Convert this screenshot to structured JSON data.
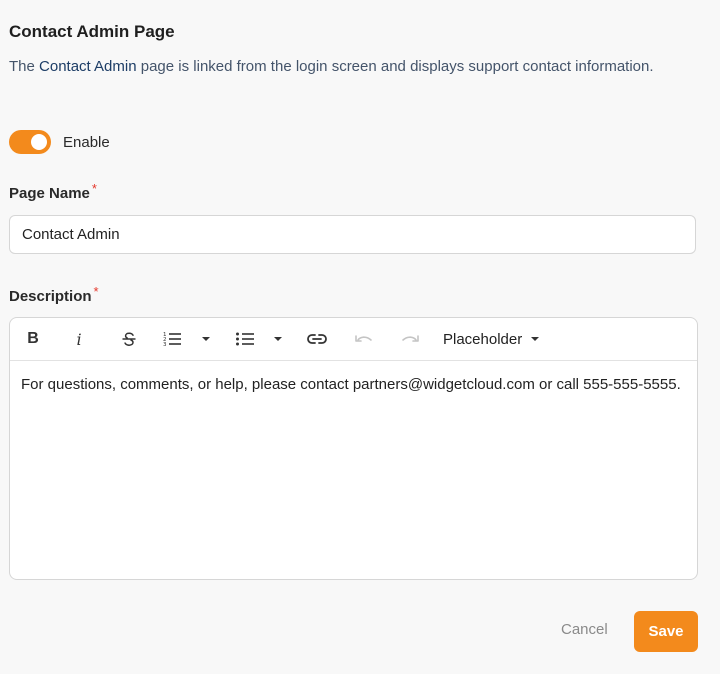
{
  "header": {
    "title": "Contact Admin Page",
    "desc_prefix": "The ",
    "desc_link": "Contact Admin",
    "desc_suffix": " page is linked from the login screen and displays support contact information."
  },
  "toggle": {
    "label": "Enable",
    "on": true,
    "color": "#f38a1c"
  },
  "page_name": {
    "label": "Page Name",
    "required_mark": "*",
    "value": "Contact Admin"
  },
  "description": {
    "label": "Description",
    "required_mark": "*",
    "toolbar": {
      "bold_label": "B",
      "italic_label": "i",
      "placeholder_label": "Placeholder",
      "icons": [
        "bold-icon",
        "italic-icon",
        "strikethrough-icon",
        "ordered-list-icon",
        "chevron-down-icon",
        "bullet-list-icon",
        "chevron-down-icon",
        "link-icon",
        "undo-icon",
        "redo-icon"
      ]
    },
    "content": "For questions, comments, or help, please contact partners@widgetcloud.com or call 555-555-5555."
  },
  "actions": {
    "cancel_label": "Cancel",
    "save_label": "Save",
    "accent": "#f38a1c"
  }
}
